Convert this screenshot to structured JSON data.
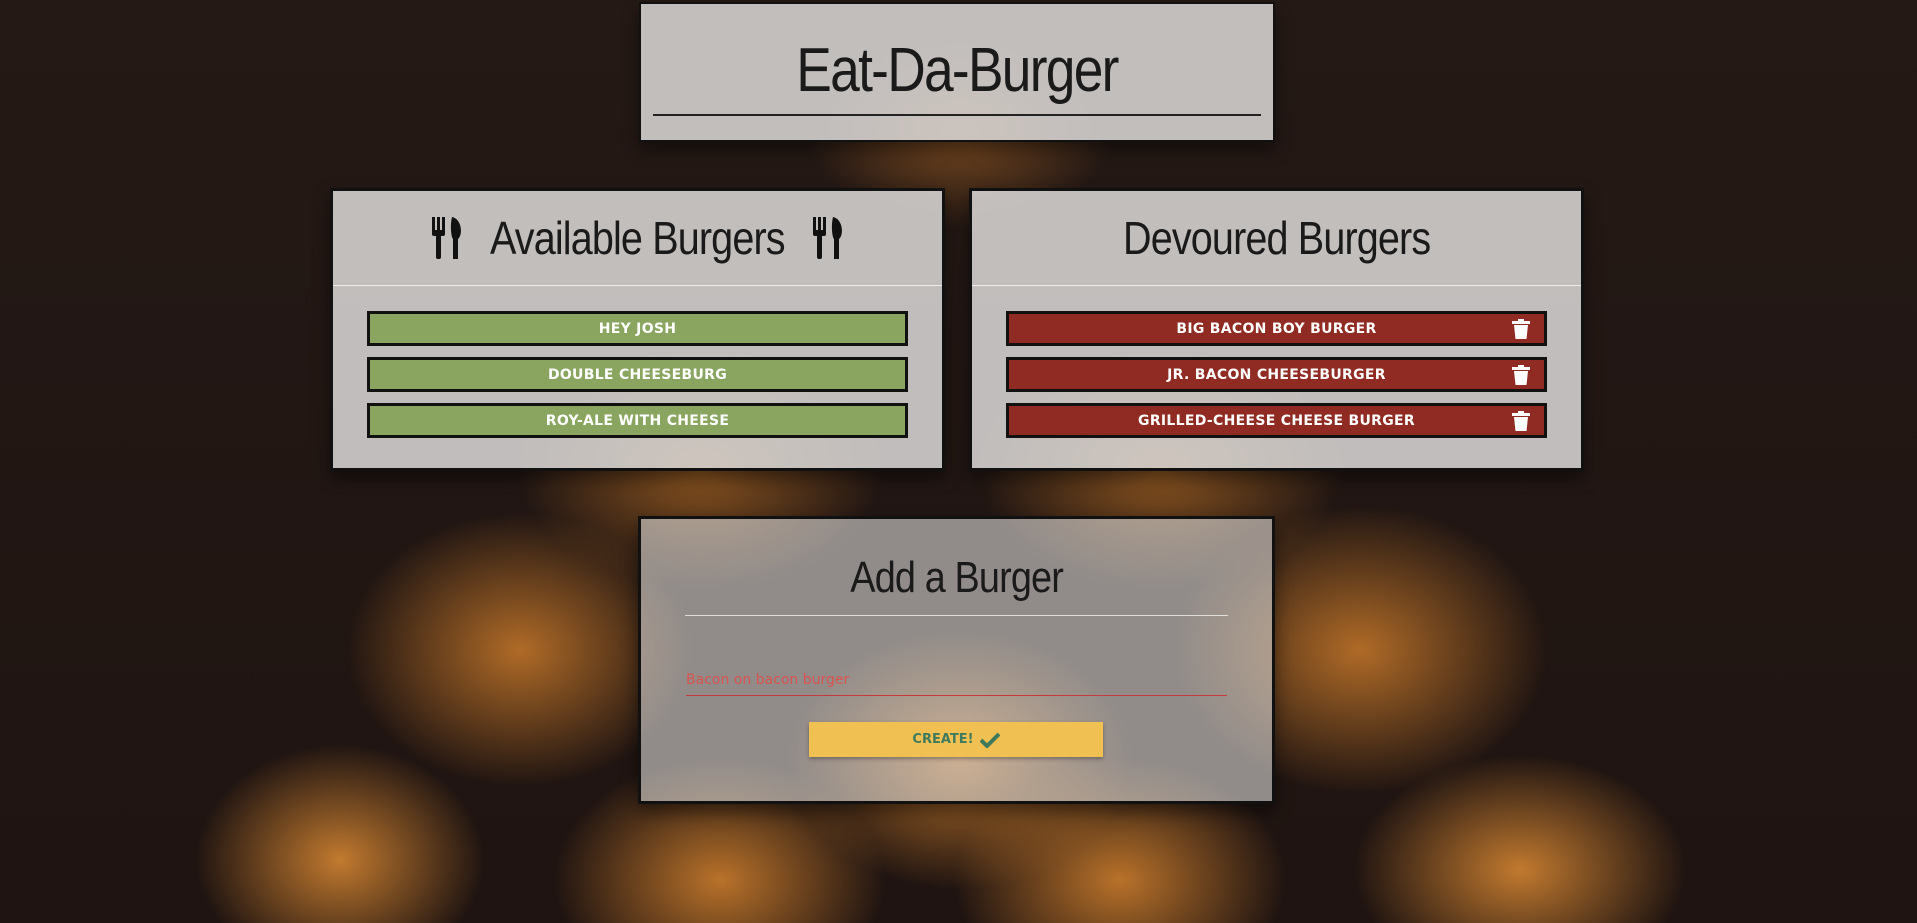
{
  "app": {
    "title": "Eat-Da-Burger"
  },
  "available": {
    "heading": "Available Burgers",
    "icon": "utensils-icon",
    "items": [
      {
        "label": "HEY JOSH"
      },
      {
        "label": "DOUBLE CHEESEBURG"
      },
      {
        "label": "ROY-ALE WITH CHEESE"
      }
    ]
  },
  "devoured": {
    "heading": "Devoured Burgers",
    "item_icon": "trash-icon",
    "items": [
      {
        "label": "BIG BACON BOY BURGER"
      },
      {
        "label": "JR. BACON CHEESEBURGER"
      },
      {
        "label": "GRILLED-CHEESE CHEESE BURGER"
      }
    ]
  },
  "add": {
    "heading": "Add a Burger",
    "input_value": "Bacon on bacon burger",
    "input_placeholder": "Bacon on bacon burger",
    "create_label": "CREATE!",
    "create_icon": "check-icon"
  },
  "colors": {
    "available_button": "#89a55f",
    "devoured_button": "#8f2b22",
    "create_button": "#f0c052",
    "input_accent": "#c63a3a"
  }
}
